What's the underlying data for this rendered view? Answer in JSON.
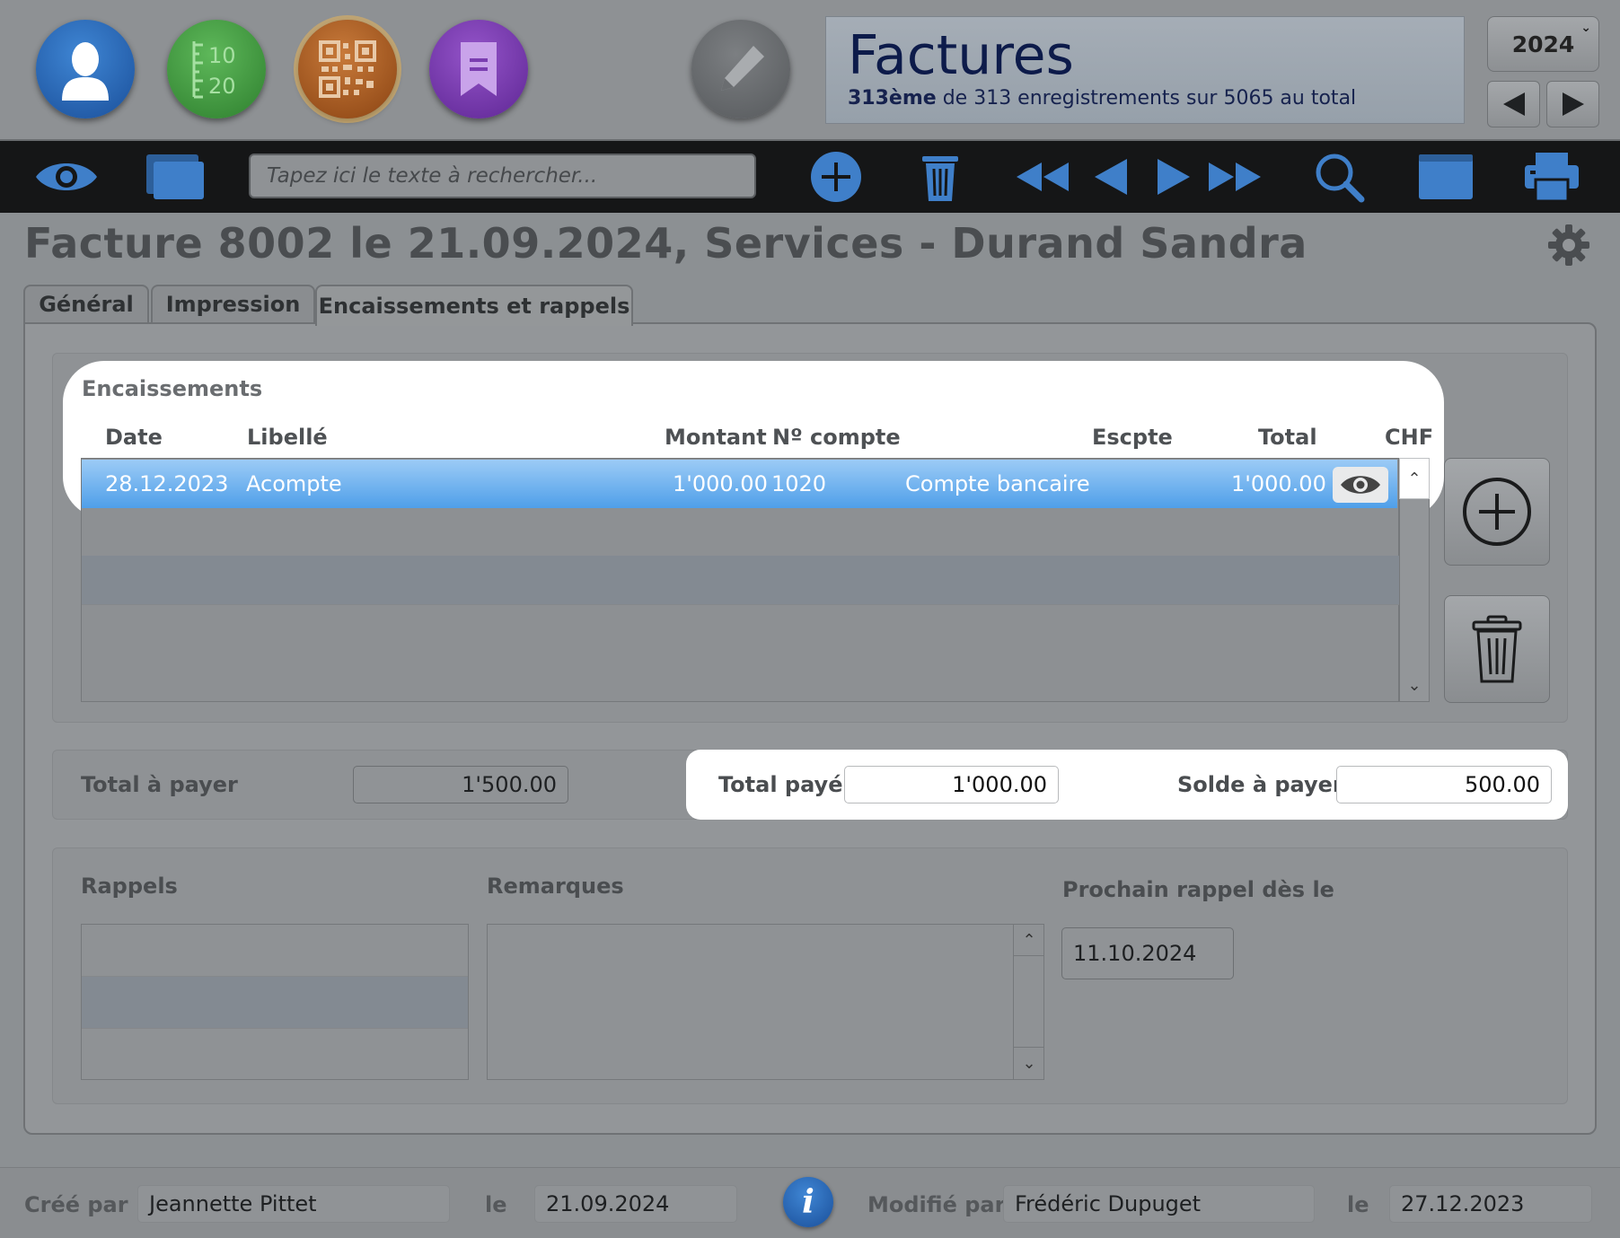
{
  "header": {
    "title": "Factures",
    "record_position": "313ème",
    "record_status": "de 313 enregistrements sur 5065 au total",
    "year": "2024",
    "buttons": [
      "contacts-icon",
      "number-range-icon",
      "qr-code-icon",
      "bookmark-icon",
      "edit-pen-icon"
    ]
  },
  "toolbar": {
    "search_placeholder": "Tapez ici le texte à rechercher...",
    "icons": [
      "eye-icon",
      "windows-icon",
      "add-icon",
      "trash-icon",
      "first-record-icon",
      "previous-record-icon",
      "next-record-icon",
      "last-record-icon",
      "search-icon",
      "window-icon",
      "print-icon"
    ]
  },
  "record": {
    "title": "Facture 8002 le 21.09.2024, Services - Durand Sandra"
  },
  "tabs": [
    {
      "label": "Général",
      "active": false
    },
    {
      "label": "Impression",
      "active": false
    },
    {
      "label": "Encaissements et rappels",
      "active": true
    }
  ],
  "encaissements": {
    "title": "Encaissements",
    "columns": [
      "Date",
      "Libellé",
      "Montant",
      "Nº compte",
      "Escpte",
      "Total",
      "CHF"
    ],
    "rows": [
      {
        "date": "28.12.2023",
        "libelle": "Acompte",
        "montant": "1'000.00",
        "compte": "1020",
        "compte_nom": "Compte bancaire",
        "escpte": "",
        "total": "1'000.00"
      }
    ]
  },
  "totals": {
    "total_a_payer_label": "Total à payer",
    "total_a_payer": "1'500.00",
    "total_paye_label": "Total payé",
    "total_paye": "1'000.00",
    "solde_label": "Solde à payer",
    "solde": "500.00"
  },
  "rappels": {
    "rappels_label": "Rappels",
    "remarques_label": "Remarques",
    "prochain_label": "Prochain rappel dès le",
    "prochain_date": "11.10.2024"
  },
  "footer": {
    "cree_par_label": "Créé par",
    "cree_par": "Jeannette Pittet",
    "le_label": "le",
    "cree_le": "21.09.2024",
    "modifie_par_label": "Modifié par",
    "modifie_par": "Frédéric Dupuget",
    "modifie_le": "27.12.2023"
  },
  "colors": {
    "selection_top": "#9ccbf6",
    "selection_bottom": "#4f9fe9",
    "title_text": "#0d1b4a",
    "accent_blue": "#1a4f9a"
  }
}
